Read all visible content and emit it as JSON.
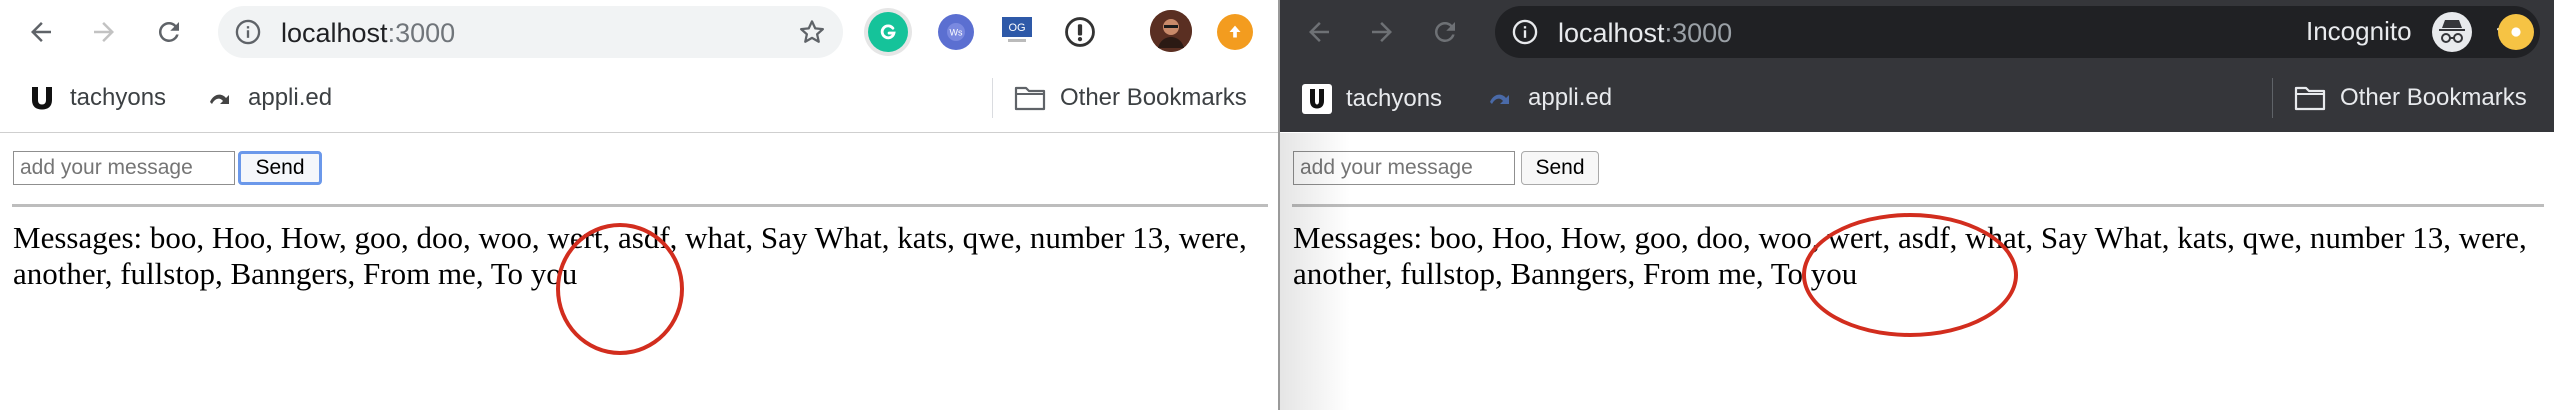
{
  "colors": {
    "annotation": "#d22d1e",
    "incognito_chrome": "#35363a",
    "focus_ring": "#6b98ea"
  },
  "windows": [
    {
      "mode": "normal",
      "nav": [
        "back-icon",
        "forward-icon",
        "reload-icon"
      ],
      "omnibox": {
        "host": "localhost",
        "port": ":3000"
      },
      "extensions": [
        "grammarly-icon",
        "wappalyzer-icon",
        "og-icon",
        "password-manager-icon",
        "profile-avatar-icon",
        "update-icon"
      ],
      "bookmarks": {
        "items": [
          {
            "label": "tachyons",
            "icon": "u-logo-icon"
          },
          {
            "label": "appli.ed",
            "icon": "appli-icon"
          }
        ],
        "other": "Other Bookmarks"
      },
      "form": {
        "placeholder": "add your message",
        "send_label": "Send",
        "send_focused": true
      },
      "messages": "Messages: boo, Hoo, How, goo, doo, woo, wert, asdf, what, Say What, kats, qwe, number 13, were, another, fullstop, Banngers, From me, To you"
    },
    {
      "mode": "incognito",
      "nav": [
        "back-icon",
        "forward-icon",
        "reload-icon"
      ],
      "omnibox": {
        "host": "localhost",
        "port": ":3000"
      },
      "incognito_label": "Incognito",
      "extensions": [
        "incognito-icon",
        "update-icon"
      ],
      "bookmarks": {
        "items": [
          {
            "label": "tachyons",
            "icon": "u-logo-icon"
          },
          {
            "label": "appli.ed",
            "icon": "appli-icon"
          }
        ],
        "other": "Other Bookmarks"
      },
      "form": {
        "placeholder": "add your message",
        "send_label": "Send",
        "send_focused": false
      },
      "messages": "Messages: boo, Hoo, How, goo, doo, woo, wert, asdf, what, Say What, kats, qwe, number 13, were, another, fullstop, Banngers, From me, To you"
    }
  ]
}
